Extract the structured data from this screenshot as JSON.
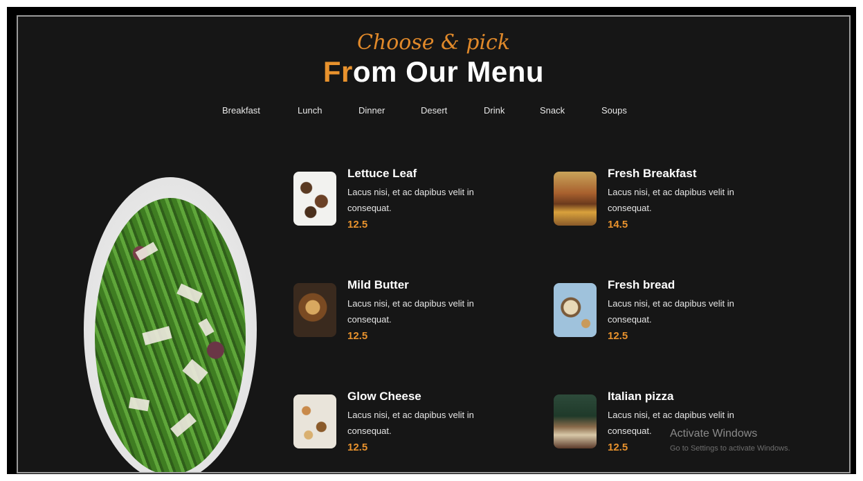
{
  "header": {
    "script_title": "Choose & pick",
    "title_accent": "Fr",
    "title_rest": "om Our Menu"
  },
  "nav": {
    "items": [
      "Breakfast",
      "Lunch",
      "Dinner",
      "Desert",
      "Drink",
      "Snack",
      "Soups"
    ]
  },
  "menu": {
    "items": [
      {
        "name": "Lettuce Leaf",
        "description": "Lacus nisi, et ac dapibus velit in consequat.",
        "price": "12.5"
      },
      {
        "name": "Fresh Breakfast",
        "description": "Lacus nisi, et ac dapibus velit in consequat.",
        "price": "14.5"
      },
      {
        "name": "Mild Butter",
        "description": "Lacus nisi, et ac dapibus velit in consequat.",
        "price": "12.5"
      },
      {
        "name": "Fresh bread",
        "description": "Lacus nisi, et ac dapibus velit in consequat.",
        "price": "12.5"
      },
      {
        "name": "Glow Cheese",
        "description": "Lacus nisi, et ac dapibus velit in consequat.",
        "price": "12.5"
      },
      {
        "name": "Italian pizza",
        "description": "Lacus nisi, et ac dapibus velit in consequat.",
        "price": "12.5"
      }
    ]
  },
  "watermark": {
    "title": "Activate Windows",
    "subtitle": "Go to Settings to activate Windows."
  },
  "colors": {
    "accent": "#e8922d",
    "background": "#161616",
    "text": "#ffffff"
  }
}
